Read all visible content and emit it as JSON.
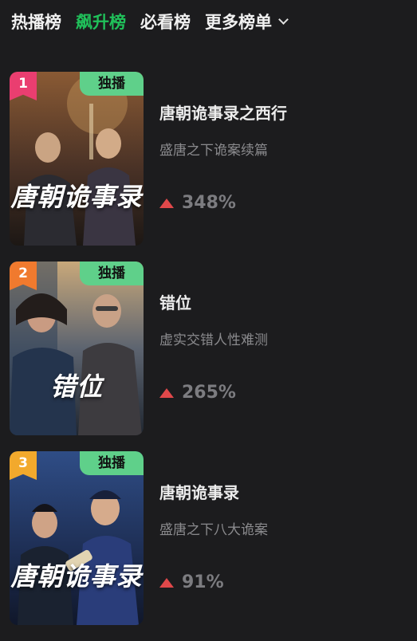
{
  "tabs": [
    {
      "label": "热播榜"
    },
    {
      "label": "飙升榜"
    },
    {
      "label": "必看榜"
    },
    {
      "label": "更多榜单"
    }
  ],
  "active_tab_index": 1,
  "items": [
    {
      "rank": "1",
      "badge": "独播",
      "poster_title": "唐朝诡事录",
      "title": "唐朝诡事录之西行",
      "subtitle": "盛唐之下诡案续篇",
      "growth": "348%"
    },
    {
      "rank": "2",
      "badge": "独播",
      "poster_title": "错位",
      "title": "错位",
      "subtitle": "虚实交错人性难测",
      "growth": "265%"
    },
    {
      "rank": "3",
      "badge": "独播",
      "poster_title": "唐朝诡事录",
      "title": "唐朝诡事录",
      "subtitle": "盛唐之下八大诡案",
      "growth": "91%"
    }
  ],
  "colors": {
    "background": "#1c1c1e",
    "active_tab": "#20c05a",
    "badge": "#5fd08a",
    "rank1": "#ea3e70",
    "rank2": "#f07a2e",
    "rank3": "#f2a92c",
    "growth_arrow": "#e0484a"
  },
  "icons": {
    "more_tabs": "chevron-down-icon",
    "growth": "trend-up-icon"
  }
}
